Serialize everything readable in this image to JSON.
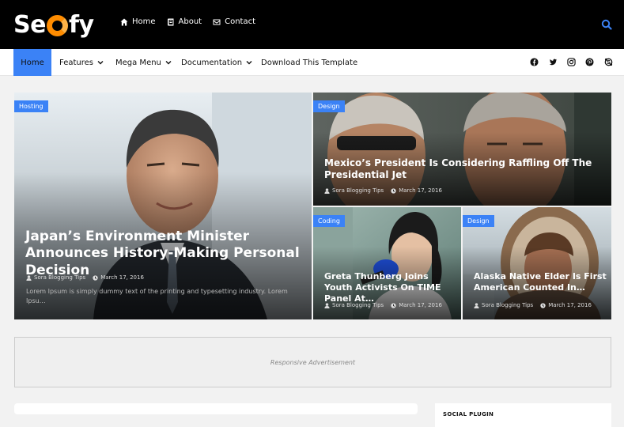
{
  "logo": {
    "left": "Se",
    "right": "fy"
  },
  "top_links": [
    {
      "label": "Home",
      "icon": "home-icon"
    },
    {
      "label": "About",
      "icon": "book-icon"
    },
    {
      "label": "Contact",
      "icon": "envelope-icon"
    }
  ],
  "nav": {
    "items": [
      {
        "label": "Home",
        "active": true
      },
      {
        "label": "Features",
        "dropdown": true
      },
      {
        "label": "Mega Menu",
        "dropdown": true
      },
      {
        "label": "Documentation",
        "dropdown": true
      },
      {
        "label": "Download This Template"
      }
    ],
    "social_icons": [
      "facebook-icon",
      "twitter-icon",
      "instagram-icon",
      "pinterest-icon",
      "skype-icon"
    ]
  },
  "posts": [
    {
      "tag": "Hosting",
      "title": "Japan’s Environment Minister Announces History-Making Personal Decision",
      "author": "Sora Blogging Tips",
      "date": "March 17, 2016",
      "excerpt": "Lorem Ipsum is simply dummy text of the printing and typesetting industry. Lorem Ipsu…"
    },
    {
      "tag": "Design",
      "title": "Mexico’s President Is Considering Raffling Off The Presidential Jet",
      "author": "Sora Blogging Tips",
      "date": "March 17, 2016"
    },
    {
      "tag": "Coding",
      "title": "Greta Thunberg Joins Youth Activists On TIME Panel At…",
      "author": "Sora Blogging Tips",
      "date": "March 17, 2016"
    },
    {
      "tag": "Design",
      "title": "Alaska Native Elder Is First American Counted In…",
      "author": "Sora Blogging Tips",
      "date": "March 17, 2016"
    }
  ],
  "ad_text": "Responsive Advertisement",
  "sidebar": {
    "title": "SOCIAL PLUGIN"
  },
  "colors": {
    "accent": "#3b82f6",
    "logo_orange": "#ff8c00",
    "header_bg": "#000000"
  }
}
